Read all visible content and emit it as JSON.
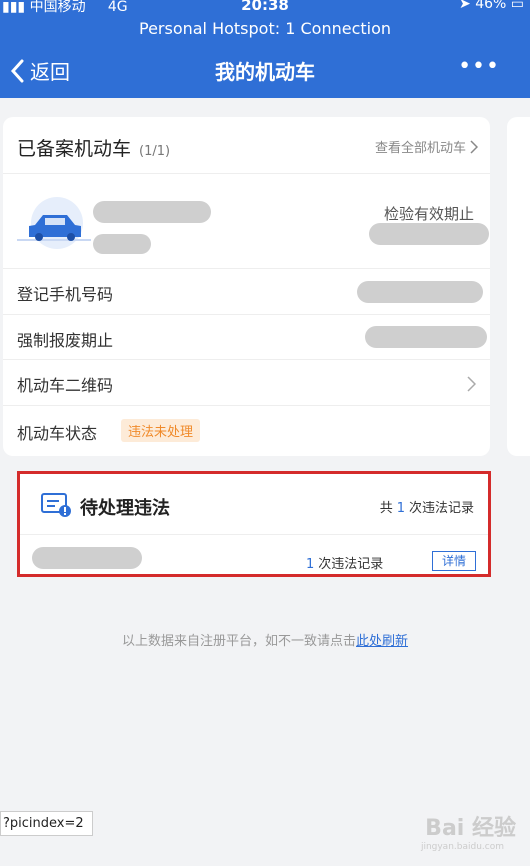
{
  "status_bar": {
    "carrier": "中国移动",
    "network": "4G",
    "time": "20:38",
    "battery": "46%",
    "hotspot": "Personal Hotspot: 1 Connection"
  },
  "navbar": {
    "back_label": "返回",
    "title": "我的机动车",
    "more_label": "•••"
  },
  "vehicle_card": {
    "title": "已备案机动车",
    "count": "(1/1)",
    "view_all": "查看全部机动车",
    "inspection_label": "检验有效期止",
    "rows": [
      {
        "label": "登记手机号码"
      },
      {
        "label": "强制报废期止"
      },
      {
        "label": "机动车二维码"
      },
      {
        "label": "机动车状态",
        "badge": "违法未处理"
      }
    ]
  },
  "violation": {
    "title": "待处理违法",
    "total_prefix": "共",
    "total_count": "1",
    "total_suffix": "次违法记录",
    "row_count": "1",
    "row_suffix": "次违法记录",
    "detail_button": "详情"
  },
  "footer": {
    "text": "以上数据来自注册平台，如不一致请点击",
    "link": "此处刷新"
  },
  "url_tip": "?picindex=2",
  "watermark": {
    "brand": "Bai 经验",
    "url": "jingyan.baidu.com"
  },
  "colors": {
    "primary": "#2f6fd6",
    "badge_bg": "#fdebd8",
    "badge_text": "#f08a2a",
    "highlight_border": "#d42b2b"
  }
}
